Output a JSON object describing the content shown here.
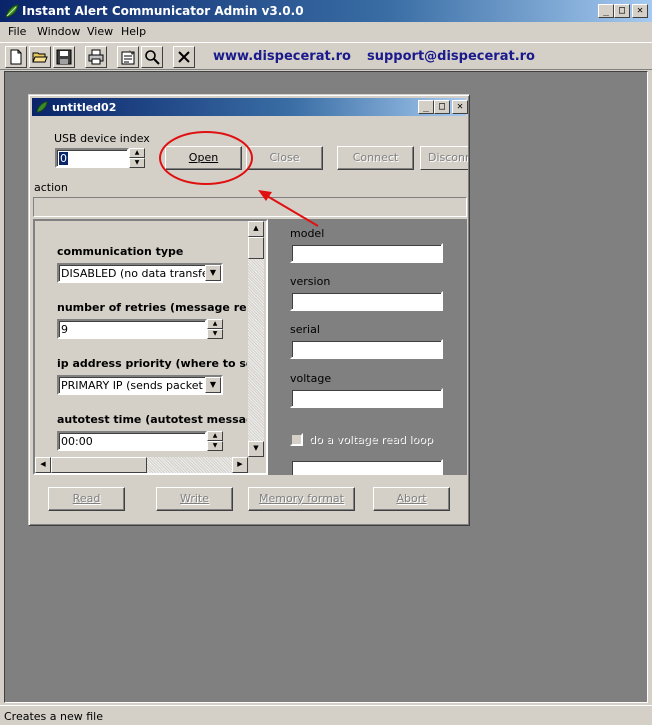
{
  "app": {
    "title": "Instant Alert Communicator Admin v3.0.0",
    "controls": {
      "minimize": "_",
      "maximize": "□",
      "close": "✕"
    }
  },
  "menu": [
    "File",
    "Window",
    "View",
    "Help"
  ],
  "toolbar": {
    "buttons": [
      "new-file-icon",
      "open-folder-icon",
      "save-disk-icon",
      "print-icon",
      "properties-icon",
      "search-icon",
      "close-x-icon"
    ],
    "website": "www.dispecerat.ro",
    "email": "support@dispecerat.ro"
  },
  "child": {
    "title": "untitled02",
    "usb_label": "USB device index",
    "usb_value": "0",
    "buttons": {
      "open": "Open",
      "close": "Close",
      "connect": "Connect",
      "disconnect": "Disconne"
    },
    "action_label": "action",
    "action_value": "",
    "settings": {
      "communication_type_label": "communication type",
      "communication_type_value": "DISABLED (no data transfer)",
      "retries_label": "number of retries (message resen",
      "retries_value": "9",
      "ip_priority_label": "ip address priority (where to send",
      "ip_priority_value": "PRIMARY IP (sends packet to",
      "autotest_label": "autotest time (autotest message",
      "autotest_value": "00:00"
    },
    "info": {
      "model_label": "model",
      "model_value": "",
      "version_label": "version",
      "version_value": "",
      "serial_label": "serial",
      "serial_value": "",
      "voltage_label": "voltage",
      "voltage_value": "",
      "loop_label": "do a voltage read loop",
      "loop_checked": false
    },
    "bottom_buttons": {
      "read": "Read",
      "write": "Write",
      "memory_format": "Memory format",
      "abort": "Abort"
    }
  },
  "status": "Creates a new file",
  "annotation_color": "#e01010"
}
